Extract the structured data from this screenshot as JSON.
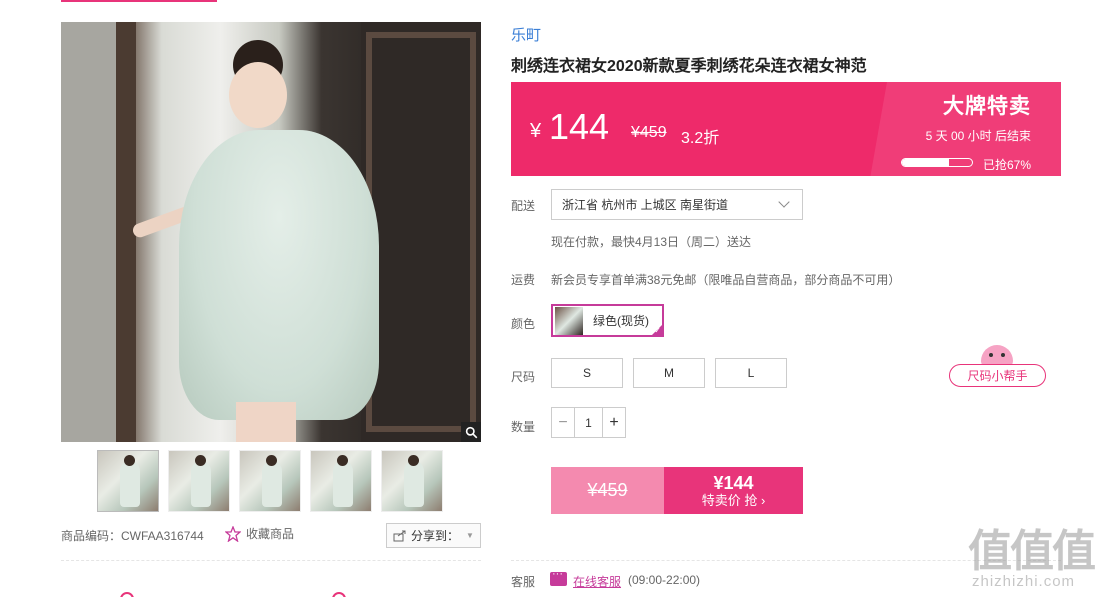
{
  "product": {
    "brand": "乐町",
    "title": "刺绣连衣裙女2020新款夏季刺绣花朵连衣裙女神范",
    "code_label": "商品编码：",
    "code": "CWFAA316744",
    "favorite_label": "收藏商品",
    "share_label": "分享到："
  },
  "price": {
    "currency": "¥",
    "now": "144",
    "old": "¥459",
    "discount": "3.2折",
    "promo_title": "大牌特卖",
    "countdown": "5 天 00 小时 后结束",
    "sold_fraction": 0.67,
    "sold_text": "已抢67%"
  },
  "delivery": {
    "label": "配送",
    "address": "浙江省 杭州市 上城区 南星街道",
    "note": "现在付款，最快4月13日（周二）送达"
  },
  "shipping": {
    "label": "运费",
    "note": "新会员专享首单满38元免邮（限唯品自营商品，部分商品不可用）"
  },
  "color": {
    "label": "颜色",
    "selected": "绿色(现货)"
  },
  "size": {
    "label": "尺码",
    "options": [
      "S",
      "M",
      "L"
    ],
    "helper": "尺码小帮手"
  },
  "quantity": {
    "label": "数量",
    "minus": "−",
    "value": "1",
    "plus": "+"
  },
  "buy": {
    "old_price": "¥459",
    "new_price": "¥144",
    "action": "特卖价 抢 ›"
  },
  "service": {
    "label": "客服",
    "link": "在线客服",
    "hours": "(09:00-22:00)"
  },
  "watermark": {
    "big": "值值值",
    "small": "zhizhizhi.com"
  },
  "colors": {
    "accent": "#e8347a",
    "banner": "#ee2a6a",
    "link": "#3b7fd6",
    "purple": "#c63b9a"
  }
}
